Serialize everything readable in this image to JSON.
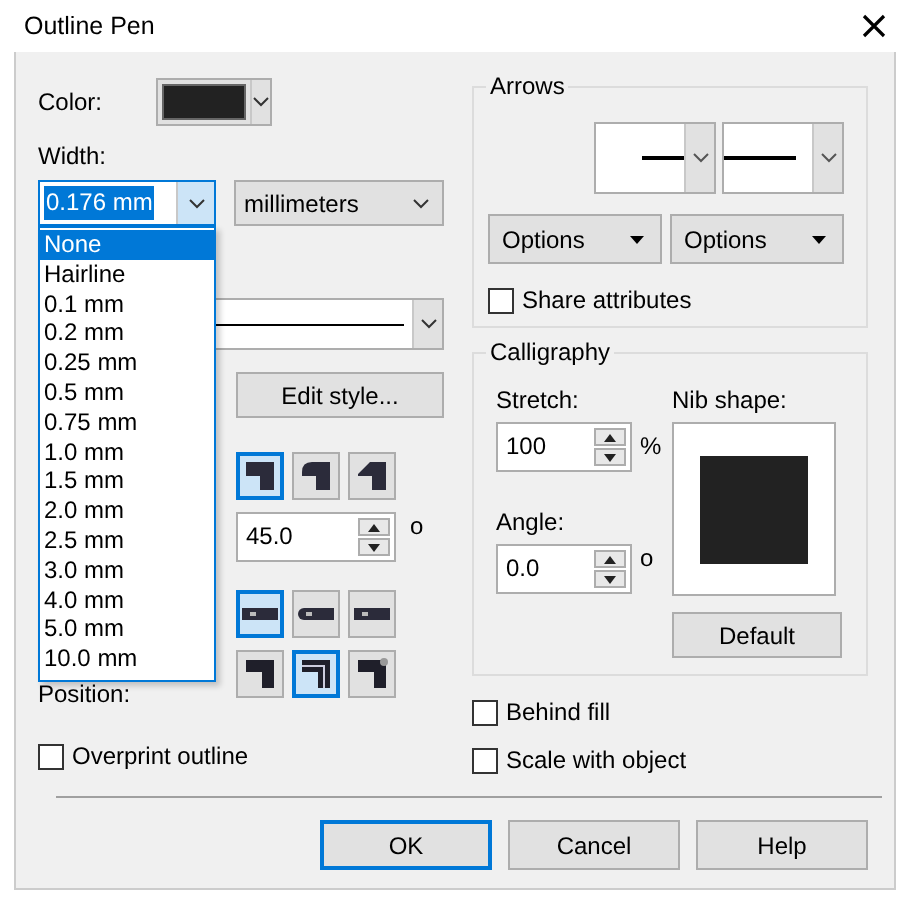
{
  "window": {
    "title": "Outline Pen"
  },
  "color": {
    "label": "Color:"
  },
  "width": {
    "label": "Width:",
    "value": "0.176 mm",
    "units": "millimeters",
    "expanded": true,
    "options": [
      {
        "label": "None",
        "selected": true
      },
      {
        "label": "Hairline",
        "selected": false
      },
      {
        "label": "0.1 mm",
        "selected": false
      },
      {
        "label": "0.2 mm",
        "selected": false
      },
      {
        "label": "0.25 mm",
        "selected": false
      },
      {
        "label": "0.5 mm",
        "selected": false
      },
      {
        "label": "0.75 mm",
        "selected": false
      },
      {
        "label": "1.0 mm",
        "selected": false
      },
      {
        "label": "1.5 mm",
        "selected": false
      },
      {
        "label": "2.0 mm",
        "selected": false
      },
      {
        "label": "2.5 mm",
        "selected": false
      },
      {
        "label": "3.0 mm",
        "selected": false
      },
      {
        "label": "4.0 mm",
        "selected": false
      },
      {
        "label": "5.0 mm",
        "selected": false
      },
      {
        "label": "10.0 mm",
        "selected": false
      }
    ]
  },
  "edit_style_button": "Edit style...",
  "corners": [
    {
      "kind": "miter",
      "selected": true
    },
    {
      "kind": "round",
      "selected": false
    },
    {
      "kind": "bevel",
      "selected": false
    }
  ],
  "miter_limit": {
    "value": "45.0",
    "unit": "o"
  },
  "line_caps": [
    {
      "kind": "butt",
      "selected": true
    },
    {
      "kind": "round",
      "selected": false
    },
    {
      "kind": "square",
      "selected": false
    }
  ],
  "position": {
    "label": "Position:",
    "options": [
      {
        "kind": "outside",
        "selected": false
      },
      {
        "kind": "center",
        "selected": true
      },
      {
        "kind": "inside",
        "selected": false
      }
    ]
  },
  "overprint_outline": {
    "label": "Overprint outline",
    "checked": false
  },
  "arrows": {
    "title": "Arrows",
    "options_buttons": [
      "Options",
      "Options"
    ],
    "share_attributes": {
      "label": "Share attributes",
      "checked": false
    }
  },
  "calligraphy": {
    "title": "Calligraphy",
    "stretch": {
      "label": "Stretch:",
      "value": "100",
      "unit": "%"
    },
    "nib_shape_label": "Nib shape:",
    "angle": {
      "label": "Angle:",
      "value": "0.0",
      "unit": "o"
    },
    "default_button": "Default"
  },
  "behind_fill": {
    "label": "Behind fill",
    "checked": false
  },
  "scale_with_object": {
    "label": "Scale with object",
    "checked": false
  },
  "buttons": [
    {
      "label": "OK",
      "default": true
    },
    {
      "label": "Cancel",
      "default": false
    },
    {
      "label": "Help",
      "default": false
    }
  ]
}
